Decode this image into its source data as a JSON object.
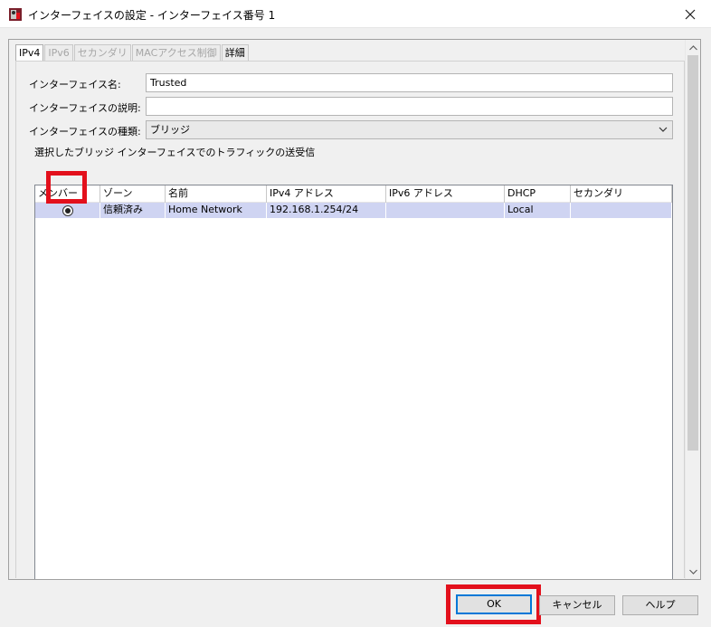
{
  "window": {
    "title": "インターフェイスの設定 - インターフェイス番号 1",
    "close_icon": "close-icon"
  },
  "tabs": [
    {
      "label": "IPv4",
      "state": "active"
    },
    {
      "label": "IPv6",
      "state": "disabled"
    },
    {
      "label": "セカンダリ",
      "state": "disabled"
    },
    {
      "label": "MACアクセス制御",
      "state": "disabled"
    },
    {
      "label": "詳細",
      "state": "enabled"
    }
  ],
  "form": {
    "name_label": "インターフェイス名:",
    "name_value": "Trusted",
    "description_label": "インターフェイスの説明:",
    "description_value": "",
    "type_label": "インターフェイスの種類:",
    "type_value": "ブリッジ"
  },
  "bridge_section": {
    "label": "選択したブリッジ インターフェイスでのトラフィックの送受信",
    "columns": [
      "メンバー",
      "ゾーン",
      "名前",
      "IPv4 アドレス",
      "IPv6 アドレス",
      "DHCP",
      "セカンダリ"
    ],
    "rows": [
      {
        "member_selected": true,
        "zone": "信頼済み",
        "name": "Home Network",
        "ipv4": "192.168.1.254/24",
        "ipv6": "",
        "dhcp": "Local",
        "secondary": ""
      }
    ]
  },
  "buttons": {
    "ok": "OK",
    "cancel": "キャンセル",
    "help": "ヘルプ"
  },
  "colors": {
    "selection_row": "#cfd4f2",
    "highlight_annotation": "#e3101c",
    "default_button_border": "#0078d7"
  }
}
